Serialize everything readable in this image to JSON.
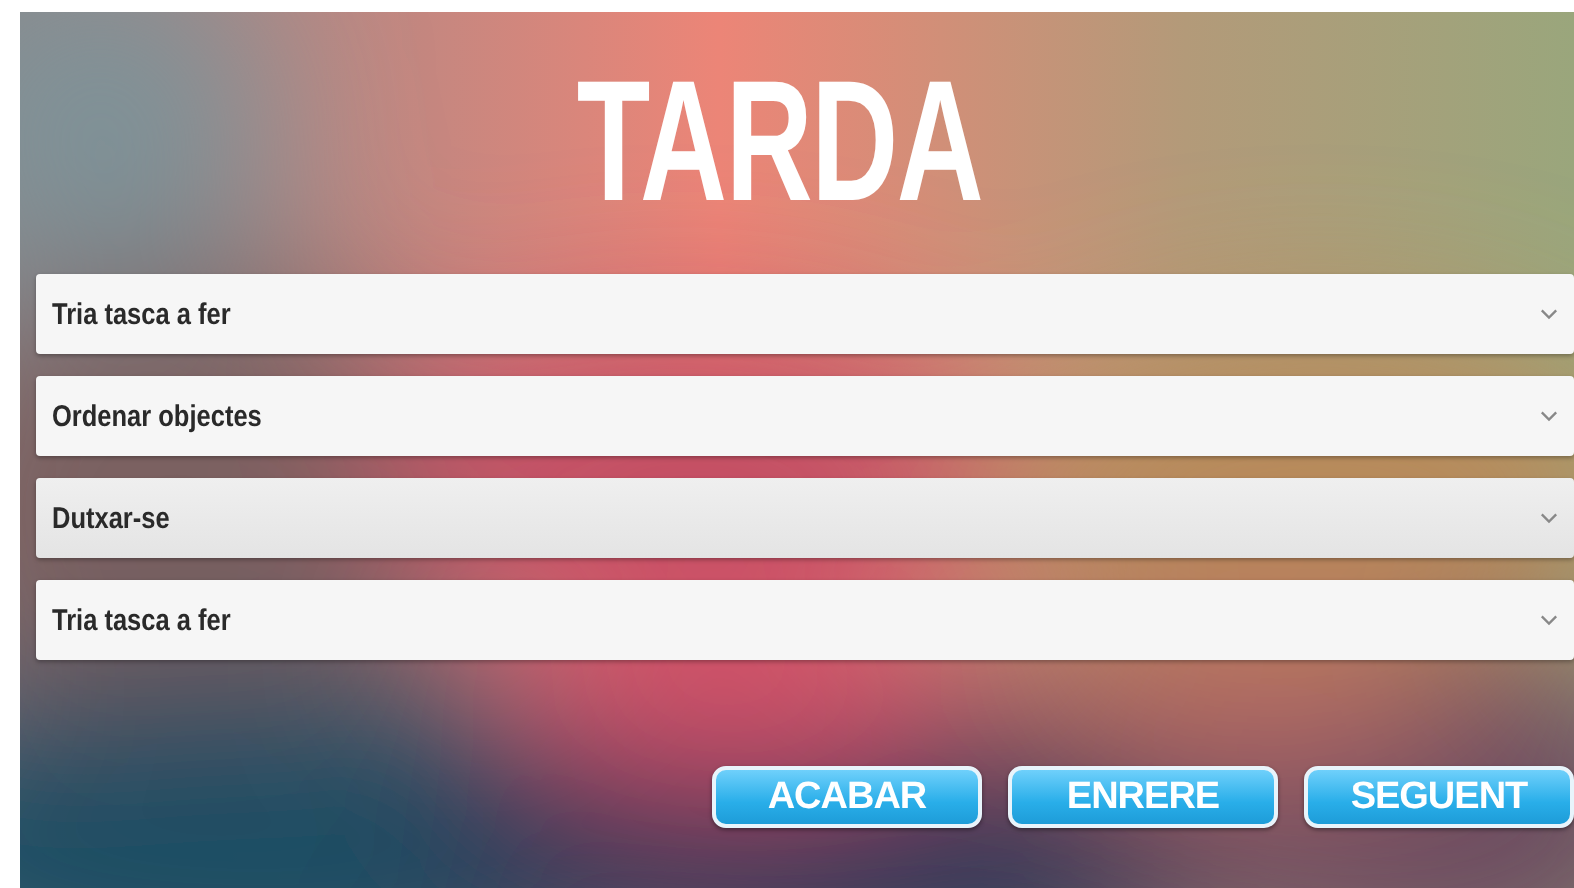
{
  "title": "TARDA",
  "selects": [
    {
      "value": "Tria tasca a fer",
      "focused": false
    },
    {
      "value": "Ordenar objectes",
      "focused": false
    },
    {
      "value": "Dutxar-se",
      "focused": true
    },
    {
      "value": "Tria tasca a fer",
      "focused": false
    }
  ],
  "buttons": [
    "ACABAR",
    "ENRERE",
    "SEGUENT"
  ]
}
